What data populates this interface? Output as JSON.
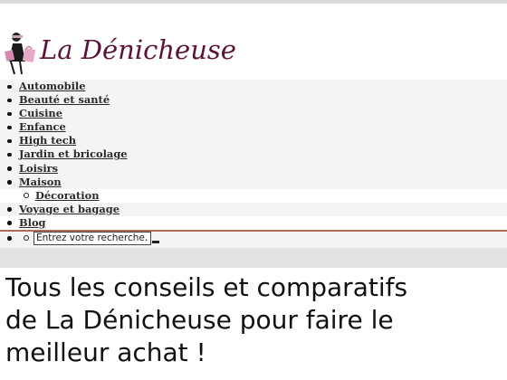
{
  "site": {
    "logo_text": "La Dénicheuse",
    "logo_icon": "woman-shopping-bags-icon",
    "brand_color": "#5b1438"
  },
  "menu": {
    "items": [
      {
        "label": "Automobile"
      },
      {
        "label": "Beauté et santé"
      },
      {
        "label": "Cuisine"
      },
      {
        "label": "Enfance"
      },
      {
        "label": "High tech"
      },
      {
        "label": "Jardin et bricolage"
      },
      {
        "label": "Loisirs"
      },
      {
        "label": "Maison",
        "children": [
          {
            "label": "Décoration"
          }
        ]
      },
      {
        "label": "Voyage et bagage"
      },
      {
        "label": "Blog"
      }
    ]
  },
  "search": {
    "placeholder": "Entrez votre recherche..."
  },
  "hero": {
    "title": "Tous les conseils et comparatifs de La Dénicheuse pour faire le meilleur achat !"
  }
}
